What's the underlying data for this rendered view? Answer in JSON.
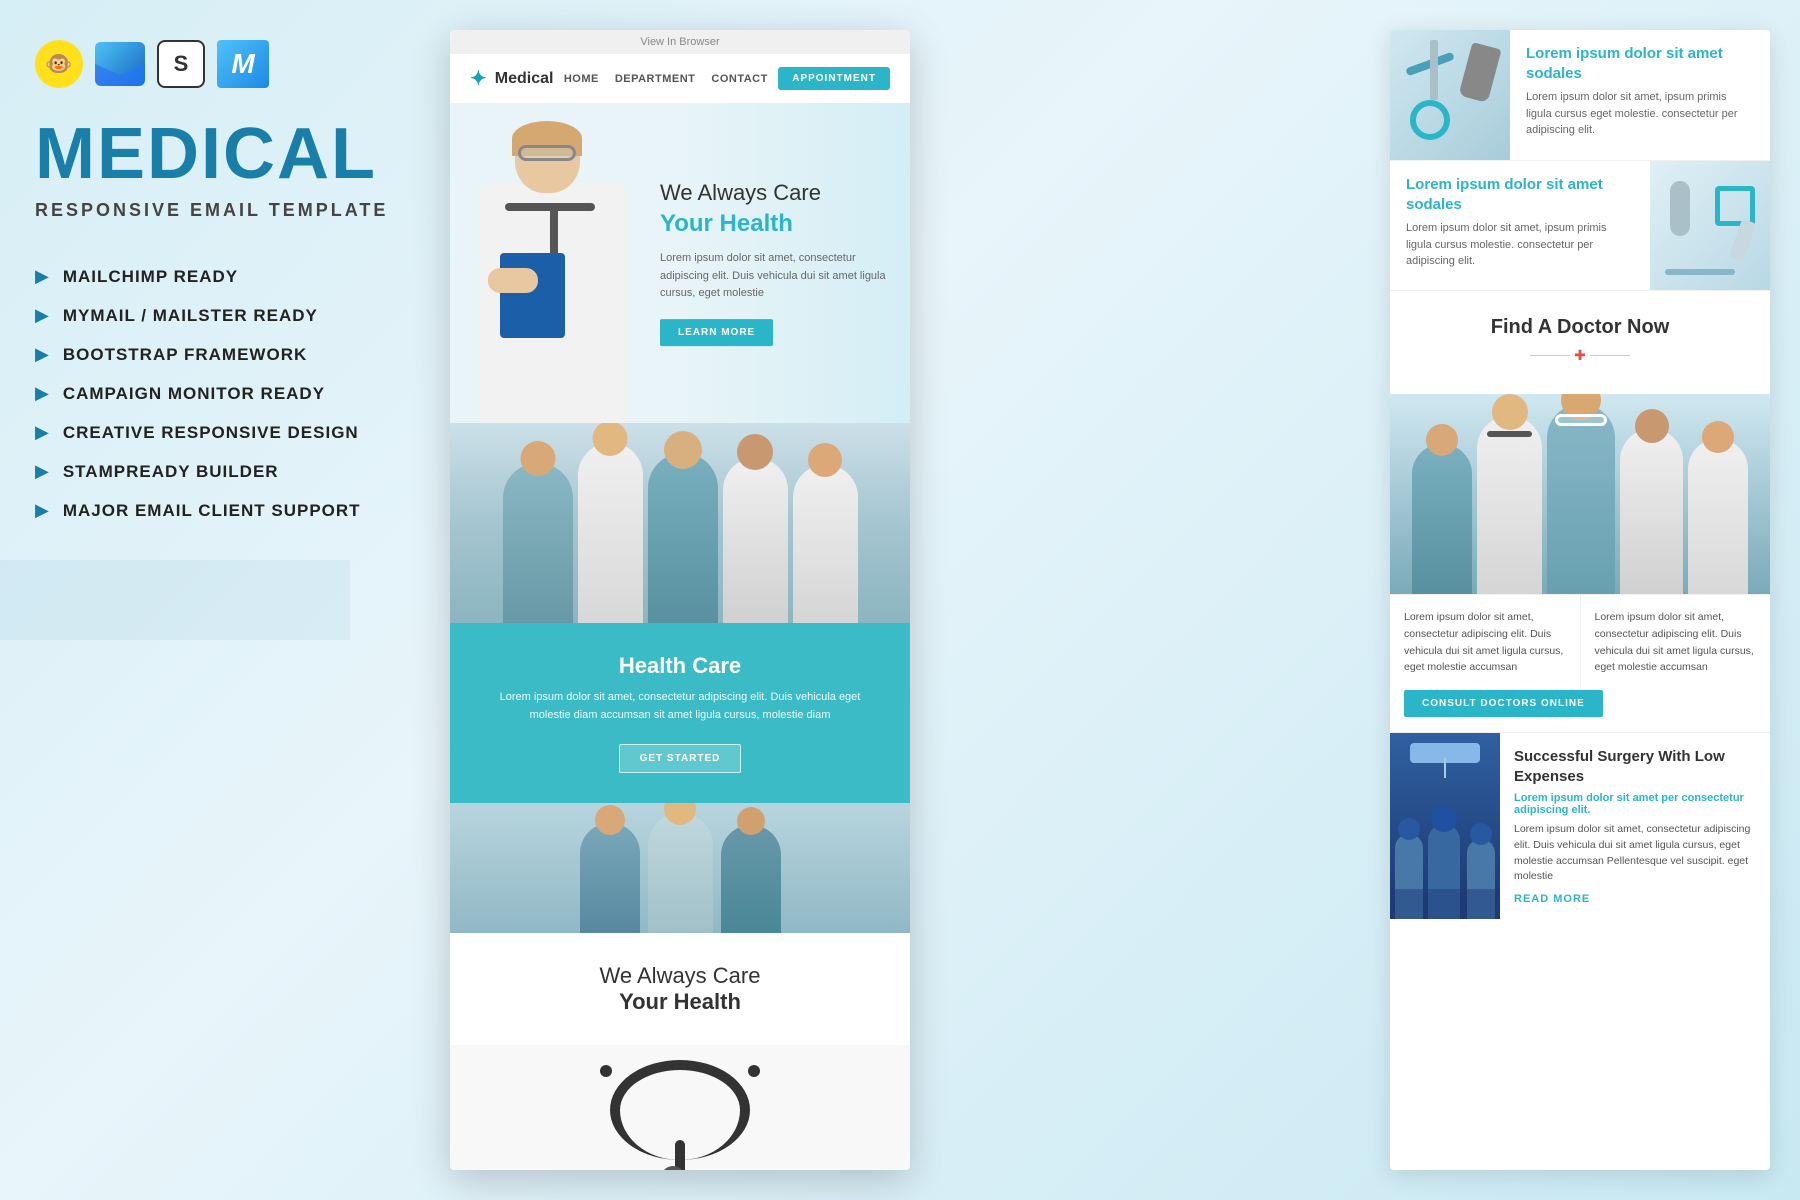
{
  "background": {
    "color": "#d6eef5"
  },
  "left_panel": {
    "icons": [
      {
        "name": "mailchimp-icon",
        "symbol": "🐒"
      },
      {
        "name": "mymail-icon",
        "symbol": "✉"
      },
      {
        "name": "stampready-icon",
        "symbol": "S"
      },
      {
        "name": "major-icon",
        "symbol": "M"
      }
    ],
    "brand_title": "MEDICAL",
    "brand_subtitle": "RESPONSIVE EMAIL TEMPLATE",
    "features": [
      {
        "icon": "▶",
        "text": "MAILCHIMP READY"
      },
      {
        "icon": "▶",
        "text": "MYMAIL / MAILSTER READY"
      },
      {
        "icon": "▶",
        "text": "BOOTSTRAP FRAMEWORK"
      },
      {
        "icon": "▶",
        "text": "CAMPAIGN MONITOR READY"
      },
      {
        "icon": "▶",
        "text": "CREATIVE RESPONSIVE DESIGN"
      },
      {
        "icon": "▶",
        "text": "STAMPREADY BUILDER"
      },
      {
        "icon": "▶",
        "text": "MAJOR EMAIL CLIENT SUPPORT"
      }
    ]
  },
  "email_mockup": {
    "view_in_browser": "View In Browser",
    "nav": {
      "logo_text": "Medical",
      "links": [
        "HOME",
        "DEPARTMENT",
        "CONTACT"
      ],
      "cta_button": "APPOINTMENT"
    },
    "hero": {
      "heading1": "We Always Care",
      "heading2": "Your Health",
      "description": "Lorem ipsum dolor sit amet, consectetur adipiscing elit. Duis vehicula dui sit amet ligula cursus, eget molestie",
      "button": "LEARN MORE"
    },
    "health_care": {
      "title": "Health Care",
      "description": "Lorem ipsum dolor sit amet, consectetur adipiscing elit. Duis vehicula eget molestie diam accumsan sit amet ligula cursus, molestie diam",
      "button": "GET STARTED"
    },
    "bottom_preview": {
      "heading1": "We Always Care",
      "heading2": "Your Health"
    }
  },
  "right_panel": {
    "top_card": {
      "title": "Lorem ipsum dolor sit amet sodales",
      "description": "Lorem ipsum dolor sit amet, ipsum primis ligula cursus eget molestie. consectetur per adipiscing elit."
    },
    "mid_card": {
      "title": "Lorem ipsum dolor sit amet sodales",
      "description": "Lorem ipsum dolor sit amet, ipsum primis ligula cursus molestie. consectetur per adipiscing elit."
    },
    "find_doctor": {
      "title": "Find A Doctor Now"
    },
    "col1_text": "Lorem ipsum dolor sit amet, consectetur adipiscing elit. Duis vehicula dui sit amet ligula cursus, eget molestie accumsan",
    "col2_text": "Lorem ipsum dolor sit amet, consectetur adipiscing elit. Duis vehicula dui sit amet ligula cursus, eget molestie accumsan",
    "consult_btn": "CONSULT DOCTORS ONLINE",
    "surgery": {
      "title": "Successful Surgery With Low Expenses",
      "subtitle": "Lorem ipsum dolor sit amet per consectetur adipiscing elit.",
      "description": "Lorem ipsum dolor sit amet, consectetur adipiscing elit. Duis vehicula dui sit amet ligula cursus, eget molestie accumsan Pellentesque vel suscipit. eget molestie",
      "read_more": "READ MORE"
    }
  }
}
